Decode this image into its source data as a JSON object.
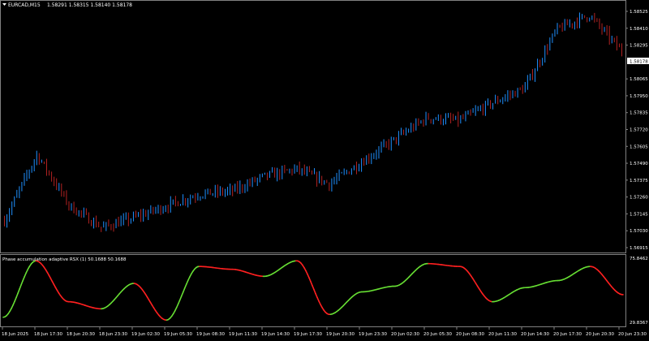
{
  "colors": {
    "background": "#000000",
    "foreground": "#ffffff",
    "bull_bar": "#1e90ff",
    "bear_bar": "#b22222",
    "rsx_up": "#66dd33",
    "rsx_down": "#ff2020",
    "frame": "#808080",
    "price_tag_bg": "#ffffff"
  },
  "main_chart": {
    "symbol_timeframe": "EURCAD,M15",
    "ohlc": "1.58291 1.58315 1.58140 1.58178",
    "current_price": "1.58178",
    "price_ticks": [
      "1.58525",
      "1.58410",
      "1.58295",
      "1.58065",
      "1.57950",
      "1.57835",
      "1.57720",
      "1.57605",
      "1.57490",
      "1.57375",
      "1.57260",
      "1.57145",
      "1.57030",
      "1.56915"
    ]
  },
  "indicator": {
    "label": "Phase accumulation adaptive RSX (1) 50.1688 50.1688",
    "top_value": "75.8462",
    "bottom_value": "29.8367"
  },
  "time_axis": [
    "18 Jun 2025",
    "18 Jun 17:30",
    "18 Jun 20:30",
    "18 Jun 23:30",
    "19 Jun 02:30",
    "19 Jun 05:30",
    "19 Jun 08:30",
    "19 Jun 11:30",
    "19 Jun 14:30",
    "19 Jun 17:30",
    "19 Jun 20:30",
    "19 Jun 23:30",
    "20 Jun 02:30",
    "20 Jun 05:30",
    "20 Jun 08:30",
    "20 Jun 11:30",
    "20 Jun 14:30",
    "20 Jun 17:30",
    "20 Jun 20:30",
    "20 Jun 23:30"
  ],
  "chart_data": [
    {
      "type": "line",
      "title": "EURCAD,M15",
      "description_values": "approximate close path of the price candles",
      "x": [
        "18 Jun 2025",
        "18 Jun 17:30",
        "18 Jun 20:30",
        "18 Jun 23:30",
        "19 Jun 02:30",
        "19 Jun 05:30",
        "19 Jun 08:30",
        "19 Jun 11:30",
        "19 Jun 14:30",
        "19 Jun 17:30",
        "19 Jun 20:30",
        "19 Jun 23:30",
        "20 Jun 02:30",
        "20 Jun 05:30",
        "20 Jun 08:30",
        "20 Jun 11:30",
        "20 Jun 14:30",
        "20 Jun 17:30",
        "20 Jun 20:30",
        "20 Jun 23:30"
      ],
      "series": [
        {
          "values": [
            1.571,
            1.5755,
            1.572,
            1.5705,
            1.5712,
            1.572,
            1.5728,
            1.573,
            1.574,
            1.5745,
            1.5735,
            1.575,
            1.5765,
            1.578,
            1.5778,
            1.579,
            1.58,
            1.584,
            1.585,
            1.5825
          ]
        }
      ],
      "ylim": [
        1.5685,
        1.586
      ]
    },
    {
      "type": "line",
      "title": "Phase accumulation adaptive RSX (1) 50.1688 50.1688",
      "x": [
        "18 Jun 2025",
        "18 Jun 17:30",
        "18 Jun 20:30",
        "18 Jun 23:30",
        "19 Jun 02:30",
        "19 Jun 05:30",
        "19 Jun 08:30",
        "19 Jun 11:30",
        "19 Jun 14:30",
        "19 Jun 17:30",
        "19 Jun 20:30",
        "19 Jun 23:30",
        "20 Jun 02:30",
        "20 Jun 05:30",
        "20 Jun 08:30",
        "20 Jun 11:30",
        "20 Jun 14:30",
        "20 Jun 17:30",
        "20 Jun 20:30",
        "20 Jun 23:30"
      ],
      "series": [
        {
          "values": [
            34,
            74,
            45,
            40,
            58,
            32,
            70,
            68,
            63,
            74,
            36,
            52,
            56,
            72,
            70,
            45,
            55,
            60,
            70,
            50
          ]
        }
      ],
      "ylim": [
        29.8367,
        75.8462
      ]
    }
  ]
}
